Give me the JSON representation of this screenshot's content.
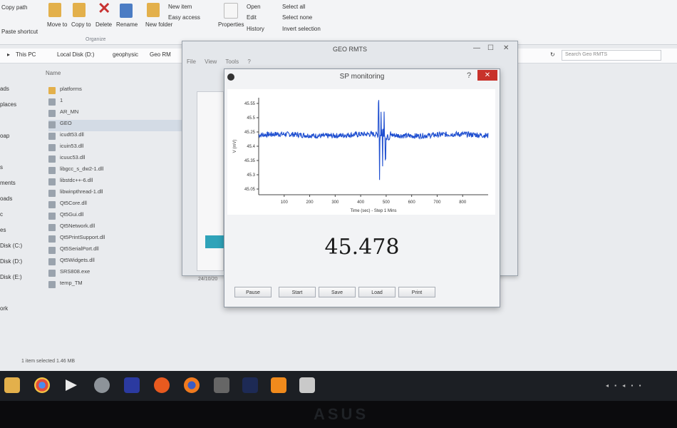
{
  "explorer": {
    "ribbon": {
      "clipboard": [
        "Copy path",
        "Paste shortcut"
      ],
      "move_to": "Move to",
      "copy_to": "Copy to",
      "delete": "Delete",
      "rename": "Rename",
      "new_folder": "New folder",
      "new_item": "New item",
      "easy_access": "Easy access",
      "properties": "Properties",
      "open": "Open",
      "edit": "Edit",
      "history": "History",
      "select_all": "Select all",
      "select_none": "Select none",
      "invert_selection": "Invert selection",
      "group_organize": "Organize"
    },
    "breadcrumbs": [
      "This PC",
      "Local Disk (D:)",
      "geophysic",
      "Geo RM"
    ],
    "search_placeholder": "Search Geo RMTS",
    "column_name": "Name",
    "nav_items": [
      "ads",
      "places",
      "",
      "oap",
      "",
      "s",
      "ments",
      "oads",
      "c",
      "es",
      "Disk (C:)",
      "Disk (D:)",
      "Disk (E:)",
      "",
      "ork"
    ],
    "files": [
      {
        "name": "platforms",
        "type": "folder"
      },
      {
        "name": "1",
        "type": "file"
      },
      {
        "name": "AR_MN",
        "type": "file"
      },
      {
        "name": "GEO",
        "type": "app",
        "selected": true
      },
      {
        "name": "icudt53.dll",
        "type": "file"
      },
      {
        "name": "icuin53.dll",
        "type": "file"
      },
      {
        "name": "icuuc53.dll",
        "type": "file"
      },
      {
        "name": "libgcc_s_dw2-1.dll",
        "type": "file"
      },
      {
        "name": "libstdc++-6.dll",
        "type": "file"
      },
      {
        "name": "libwinpthread-1.dll",
        "type": "file"
      },
      {
        "name": "Qt5Core.dll",
        "type": "file"
      },
      {
        "name": "Qt5Gui.dll",
        "type": "file"
      },
      {
        "name": "Qt5Network.dll",
        "type": "file"
      },
      {
        "name": "Qt5PrintSupport.dll",
        "type": "file"
      },
      {
        "name": "Qt5SerialPort.dll",
        "type": "file"
      },
      {
        "name": "Qt5Widgets.dll",
        "type": "file"
      },
      {
        "name": "SRS808.exe",
        "type": "file"
      },
      {
        "name": "temp_TM",
        "type": "file"
      }
    ],
    "status": "1 item selected  1.46 MB"
  },
  "geo_window": {
    "title": "GEO RMTS",
    "menu": [
      "File",
      "View",
      "Tools",
      "?"
    ],
    "bottom_label": "24/10/20"
  },
  "sp_dialog": {
    "title": "SP monitoring",
    "help": "?",
    "close": "✕",
    "value": "45.478",
    "buttons": [
      "Pause",
      "Start",
      "Save",
      "Load",
      "Print"
    ]
  },
  "chart_data": {
    "type": "line",
    "xlabel": "Time (sec) - Step 1 Mins",
    "ylabel": "V (mV)",
    "xlim": [
      0,
      900
    ],
    "ylim": [
      44.95,
      45.6
    ],
    "x_ticks": [
      100,
      200,
      300,
      400,
      500,
      600,
      700,
      800
    ],
    "y_ticks": [
      "45.55",
      "45.5",
      "45.25",
      "45.4",
      "45.35",
      "45.3",
      "45.05"
    ],
    "baseline": 45.35,
    "noise": 0.018,
    "spikes": [
      {
        "x": 470,
        "y": 45.58
      },
      {
        "x": 474,
        "y": 45.05
      },
      {
        "x": 480,
        "y": 45.53
      },
      {
        "x": 486,
        "y": 45.12
      },
      {
        "x": 492,
        "y": 45.5
      },
      {
        "x": 497,
        "y": 45.18
      }
    ],
    "series_color": "#1f4fd0"
  },
  "taskbar": {
    "apps": [
      "file-explorer-icon",
      "chrome-icon",
      "media-player-icon",
      "hdd-icon",
      "wmp-icon",
      "orange-app-icon",
      "firefox-icon",
      "calculator-icon",
      "ipt-app-icon",
      "g-app-icon",
      "geo-rmts-icon"
    ]
  },
  "bezel": {
    "brand": "ASUS"
  }
}
